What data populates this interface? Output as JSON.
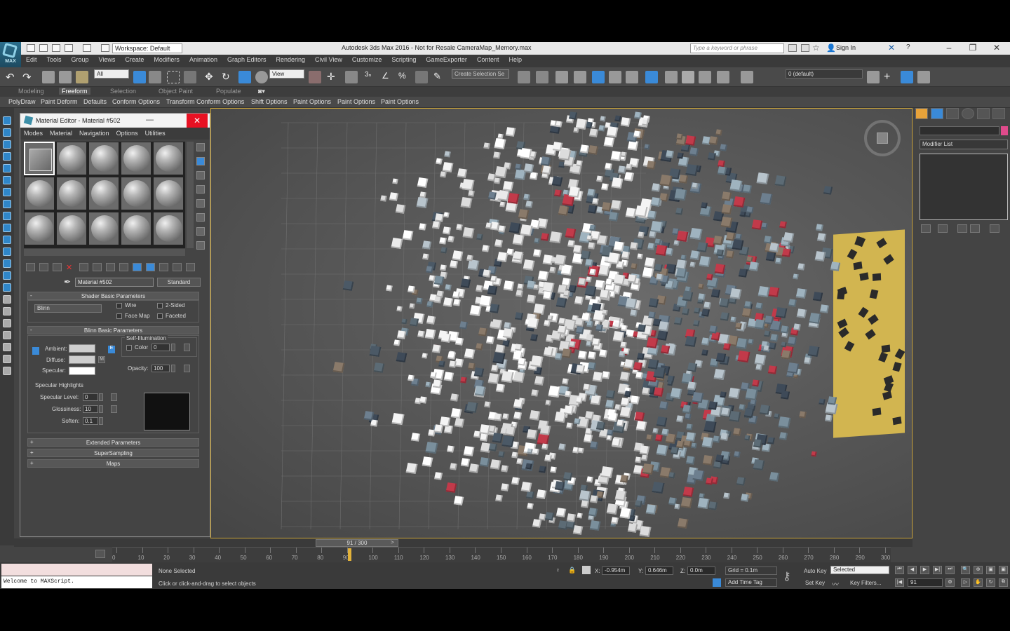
{
  "app": {
    "title": "Autodesk 3ds Max 2016 - Not for Resale   CameraMap_Memory.max",
    "logo_text": "MAX",
    "workspace": "Workspace: Default",
    "search_placeholder": "Type a keyword or phrase",
    "sign_in": "Sign In"
  },
  "menu": [
    "Edit",
    "Tools",
    "Group",
    "Views",
    "Create",
    "Modifiers",
    "Animation",
    "Graph Editors",
    "Rendering",
    "Civil View",
    "Customize",
    "Scripting",
    "GameExporter",
    "Content",
    "Help"
  ],
  "toolbar": {
    "filter": "All",
    "refcoord": "View",
    "selection_set": "Create Selection Se",
    "layer": "0 (default)"
  },
  "ribbon": {
    "tabs": [
      "Modeling",
      "Freeform",
      "Selection",
      "Object Paint",
      "Populate"
    ],
    "active_tab": "Freeform",
    "items": [
      "PolyDraw",
      "Paint Deform",
      "Defaults",
      "Conform Options",
      "Transform Conform Options",
      "Shift Options",
      "Paint Options",
      "Paint Options",
      "Paint Options"
    ]
  },
  "material_editor": {
    "title": "Material Editor - Material #502",
    "menu": [
      "Modes",
      "Material",
      "Navigation",
      "Options",
      "Utilities"
    ],
    "material_name": "Material #502",
    "material_type": "Standard",
    "shader_rollout": "Shader Basic Parameters",
    "shader": "Blinn",
    "wire": "Wire",
    "two_sided": "2-Sided",
    "face_map": "Face Map",
    "faceted": "Faceted",
    "blinn_rollout": "Blinn Basic Parameters",
    "self_illum": "Self-Illumination",
    "ambient": "Ambient:",
    "diffuse": "Diffuse:",
    "specular": "Specular:",
    "color_label": "Color",
    "color_value": "0",
    "opacity_label": "Opacity:",
    "opacity_value": "100",
    "spec_highlights": "Specular Highlights",
    "spec_level_label": "Specular Level:",
    "spec_level": "0",
    "glossiness_label": "Glossiness:",
    "glossiness": "10",
    "soften_label": "Soften:",
    "soften": "0.1",
    "rollouts": [
      "Extended Parameters",
      "SuperSampling",
      "Maps"
    ]
  },
  "command_panel": {
    "modifier_list": "Modifier List"
  },
  "timeline": {
    "slider": "91 / 300",
    "ticks": [
      "0",
      "10",
      "20",
      "30",
      "40",
      "50",
      "60",
      "70",
      "80",
      "90",
      "100",
      "110",
      "120",
      "130",
      "140",
      "150",
      "160",
      "170",
      "180",
      "190",
      "200",
      "210",
      "220",
      "230",
      "240",
      "250",
      "260",
      "270",
      "280",
      "290",
      "300"
    ],
    "current_frame": 91,
    "total_frames": 300
  },
  "status": {
    "maxscript": "Welcome to MAXScript.",
    "selection": "None Selected",
    "prompt": "Click or click-and-drag to select objects",
    "x_label": "X:",
    "x": "-0.954m",
    "y_label": "Y:",
    "y": "0.646m",
    "z_label": "Z:",
    "z": "0.0m",
    "grid": "Grid = 0.1m",
    "add_time_tag": "Add Time Tag",
    "auto_key": "Auto Key",
    "set_key": "Set Key",
    "key_mode": "Selected",
    "key_filters": "Key Filters...",
    "frame": "91"
  },
  "colors": {
    "accent_blue": "#2f86c8",
    "viewport_border": "#c9a33b",
    "close_red": "#e81123",
    "playhead": "#e2b23a"
  }
}
